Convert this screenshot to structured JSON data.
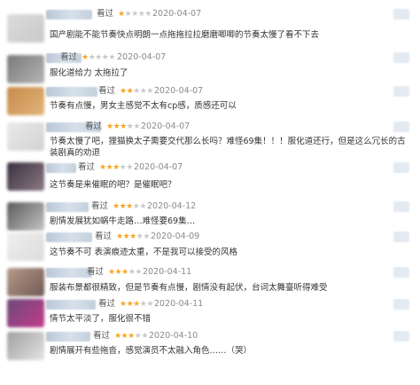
{
  "reviews": [
    {
      "seen_label": "看过",
      "rating": 1,
      "date": "2020-04-07",
      "text": "国产剧能不能节奏快点明朗一点拖拖拉拉磨磨唧唧的节奏太慢了看不下去",
      "avatar_colors": [
        "#d9d9d9",
        "#cfcfcf"
      ]
    },
    {
      "seen_label": "看过",
      "rating": 1,
      "date": "2020-04-07",
      "text": "服化道给力 太拖拉了",
      "avatar_colors": [
        "#6b6b6b",
        "#a9a9a9"
      ]
    },
    {
      "seen_label": "看过",
      "rating": 2,
      "date": "2020-04-07",
      "text": "节奏有点慢，男女主感觉不太有cp感，质感还可以",
      "avatar_colors": [
        "#c68a4a",
        "#e2b57a"
      ]
    },
    {
      "seen_label": "看过",
      "rating": 3,
      "date": "2020-04-07",
      "text": "节奏太慢了吧，狸猫换太子需要交代那么长吗？难怪69集！！！服化道还行，但是这么冗长的古装剧真的劝退",
      "avatar_colors": [
        "#e8e8e8",
        "#d4d4d4"
      ]
    },
    {
      "seen_label": "看过",
      "rating": 3,
      "date": "2020-04-07",
      "text": "这节奏是来催眠的吧？是催眠吧？",
      "avatar_colors": [
        "#3a3040",
        "#7a6a72"
      ]
    },
    {
      "seen_label": "看过",
      "rating": 3,
      "date": "2020-04-12",
      "text": "剧情发展犹如蜗牛走路…难怪要69集…",
      "avatar_colors": [
        "#5a5a5a",
        "#bcbcbc"
      ]
    },
    {
      "seen_label": "看过",
      "rating": 3,
      "date": "2020-04-09",
      "text": "这节奏不可 表演痕迹太重，不是我可以接受的风格",
      "avatar_colors": [
        "#ececec",
        "#dedede"
      ]
    },
    {
      "seen_label": "看过",
      "rating": 3,
      "date": "2020-04-11",
      "text": "服装布景都很精致，但是节奏有点慢，剧情没有起伏，台词太舞臺听得难受",
      "avatar_colors": [
        "#b89a8a",
        "#6e5a54"
      ]
    },
    {
      "seen_label": "看过",
      "rating": 3,
      "date": "2020-04-11",
      "text": "情节太平淡了，服化很不错",
      "avatar_colors": [
        "#6b4a7a",
        "#c23b8a"
      ]
    },
    {
      "seen_label": "看过",
      "rating": 3,
      "date": "2020-04-10",
      "text": "剧情展开有些拖沓，感觉演员不太融入角色……（哭）",
      "avatar_colors": [
        "#a0a0a0",
        "#e4e4e4"
      ]
    }
  ]
}
